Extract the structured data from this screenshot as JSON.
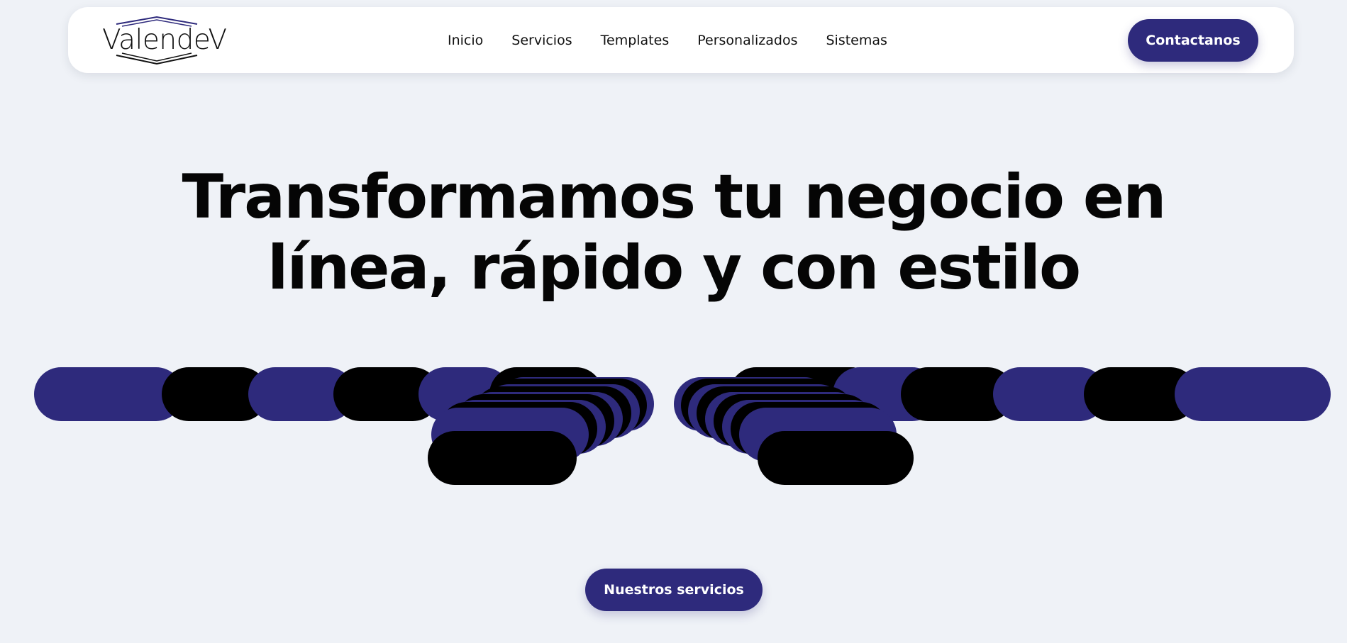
{
  "brand": {
    "name": "ValendeV"
  },
  "nav": {
    "links": [
      "Inicio",
      "Servicios",
      "Templates",
      "Personalizados",
      "Sistemas"
    ],
    "cta_label": "Contactanos"
  },
  "hero": {
    "headline_line1": "Transformamos tu negocio en",
    "headline_line2": "línea, rápido y con estilo",
    "cta_label": "Nuestros servicios"
  },
  "colors": {
    "background": "#eff2f7",
    "accent": "#2e2a7c",
    "dark": "#000000",
    "surface": "#ffffff"
  }
}
